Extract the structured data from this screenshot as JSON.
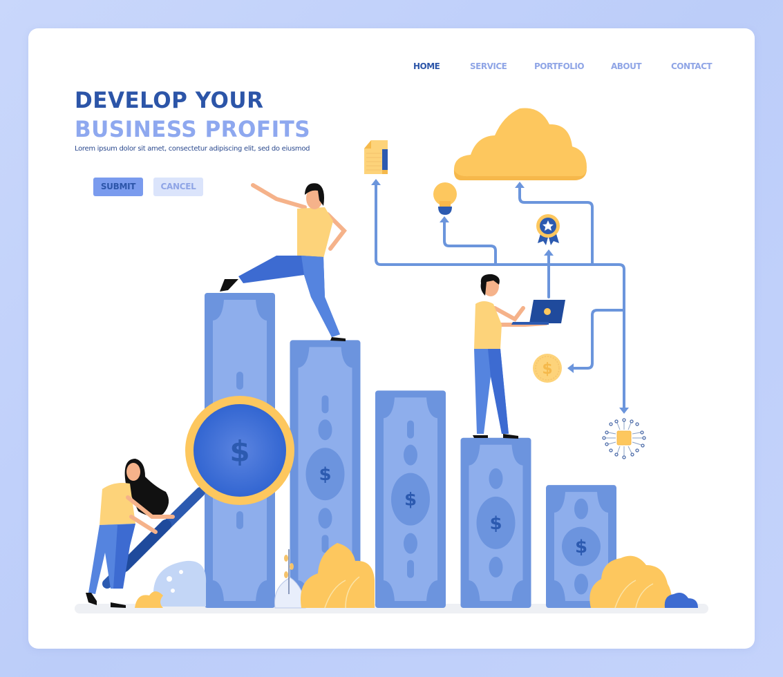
{
  "nav": {
    "items": [
      {
        "label": "HOME",
        "active": true
      },
      {
        "label": "SERVICE",
        "active": false
      },
      {
        "label": "PORTFOLIO",
        "active": false
      },
      {
        "label": "ABOUT",
        "active": false
      },
      {
        "label": "CONTACT",
        "active": false
      }
    ]
  },
  "hero": {
    "title_line1": "DEVELOP YOUR",
    "title_line2": "BUSINESS PROFITS",
    "subtitle": "Lorem ipsum dolor sit amet, consectetur adipiscing elit, sed do eiusmod",
    "submit_label": "SUBMIT",
    "cancel_label": "CANCEL"
  },
  "illustration": {
    "bars_relative_heights": [
      1.0,
      0.85,
      0.69,
      0.54,
      0.39
    ],
    "currency_symbol": "$",
    "icons": [
      "document-icon",
      "lightbulb-icon",
      "cloud-icon",
      "award-ribbon-icon",
      "coin-icon",
      "microchip-icon",
      "magnifying-glass-icon",
      "laptop-icon"
    ]
  },
  "colors": {
    "background": "#c4d3fb",
    "primary_dark": "#2c55a8",
    "primary_light": "#8ea8ef",
    "bill_outer": "#6c94de",
    "bill_inner": "#8eaeec",
    "accent_yellow": "#fdc75e",
    "button_submit_bg": "#7a9bee",
    "button_cancel_bg": "#dbe4fb"
  }
}
